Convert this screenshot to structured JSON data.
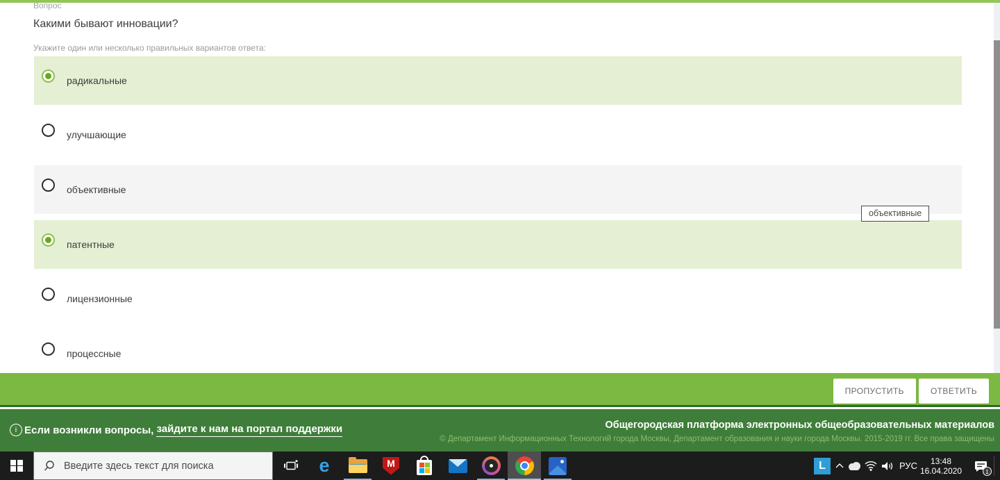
{
  "page": {
    "question_label": "Вопрос",
    "question": "Какими бывают инновации?",
    "instruction": "Укажите один или несколько правильных вариантов ответа:",
    "options": [
      {
        "label": "радикальные",
        "selected": true,
        "row_bg": "green"
      },
      {
        "label": "улучшающие",
        "selected": false,
        "row_bg": "white"
      },
      {
        "label": "объективные",
        "selected": false,
        "row_bg": "gray"
      },
      {
        "label": "патентные",
        "selected": true,
        "row_bg": "green"
      },
      {
        "label": "лицензионные",
        "selected": false,
        "row_bg": "white"
      },
      {
        "label": "процессные",
        "selected": false,
        "row_bg": "white"
      }
    ],
    "tooltip_text": "объективные",
    "actions": {
      "skip": "ПРОПУСТИТЬ",
      "answer": "ОТВЕТИТЬ"
    }
  },
  "footer": {
    "support_prefix": "Если возникли вопросы, ",
    "support_link": "зайдите к нам на портал поддержки",
    "platform_title": "Общегородская платформа электронных общеобразовательных материалов",
    "copyright": "© Департамент Информационных Технологий города Москвы, Департамент образования и науки города Москвы. 2015-2019 гг. Все права защищены"
  },
  "taskbar": {
    "search_placeholder": "Введите здесь текст для поиска",
    "apps": [
      "task-view",
      "edge",
      "file-explorer",
      "mcafee",
      "microsoft-store",
      "mail",
      "groove-music",
      "chrome",
      "photos"
    ],
    "tray_app_letter": "L",
    "language": "РУС",
    "time": "13:48",
    "date": "16.04.2020",
    "notification_count": "1"
  },
  "colors": {
    "top_strip_green": "#93c559",
    "selected_row_bg": "#e5efd4",
    "radio_green": "#8cc152",
    "radio_dot_green": "#69a91e",
    "action_bar_green": "#7cb943",
    "divider_dark_green": "#2d6a28",
    "footer_green": "#3f7e3a",
    "copyright_text_green": "#8cbe6e",
    "taskbar_bg": "#1c1c1c",
    "running_indicator_blue": "#8ab4d8"
  }
}
